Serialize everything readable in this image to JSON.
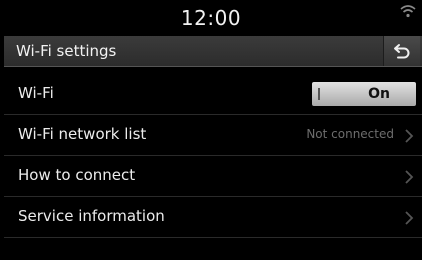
{
  "status_bar": {
    "time": "12:00",
    "wifi_icon": "wifi-signal-icon"
  },
  "header": {
    "title": "Wi-Fi settings",
    "back_icon": "back-arrow-icon"
  },
  "settings": {
    "wifi": {
      "label": "Wi-Fi",
      "toggle_value": "On"
    },
    "network_list": {
      "label": "Wi-Fi network list",
      "status": "Not connected"
    },
    "how_to_connect": {
      "label": "How to connect"
    },
    "service_information": {
      "label": "Service information"
    }
  },
  "colors": {
    "background": "#000000",
    "title_bar": "#333333",
    "toggle": "#c8c8c8",
    "muted_text": "#6d6d6d"
  }
}
